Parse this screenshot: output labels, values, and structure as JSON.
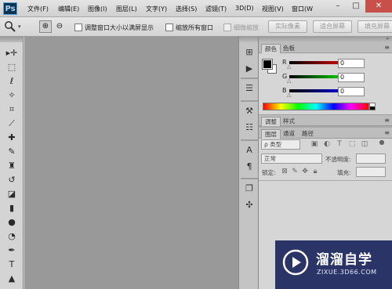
{
  "app": {
    "logo": "Ps"
  },
  "menubar": {
    "items": [
      "文件(F)",
      "编辑(E)",
      "图像(I)",
      "图层(L)",
      "文字(Y)",
      "选择(S)",
      "滤镜(T)",
      "3D(D)",
      "视图(V)",
      "窗口(W"
    ],
    "window_controls": {
      "minimize": "–",
      "maximize": "□",
      "close": "✕"
    }
  },
  "options": {
    "tool_icon": "zoom-icon",
    "zoom_in": "⊕",
    "zoom_out": "⊖",
    "resize_windows_label": "调整窗口大小以满屏显示",
    "zoom_all_windows_label": "缩放所有窗口",
    "scrubby_zoom_label": "细微缩放",
    "actual_pixels_button": "实际像素",
    "fit_screen_button": "适合屏幕",
    "fill_screen_button": "填充屏幕"
  },
  "tools": [
    {
      "name": "move-tool",
      "glyph": "▸✛"
    },
    {
      "name": "marquee-tool",
      "glyph": "⬚"
    },
    {
      "name": "lasso-tool",
      "glyph": "ℓ"
    },
    {
      "name": "quick-select-tool",
      "glyph": "✧"
    },
    {
      "name": "crop-tool",
      "glyph": "⌗"
    },
    {
      "name": "eyedropper-tool",
      "glyph": "⟋"
    },
    {
      "name": "healing-brush-tool",
      "glyph": "✚"
    },
    {
      "name": "brush-tool",
      "glyph": "✎"
    },
    {
      "name": "clone-stamp-tool",
      "glyph": "♜"
    },
    {
      "name": "history-brush-tool",
      "glyph": "↺"
    },
    {
      "name": "eraser-tool",
      "glyph": "◪"
    },
    {
      "name": "gradient-tool",
      "glyph": "▮"
    },
    {
      "name": "blur-tool",
      "glyph": "●"
    },
    {
      "name": "dodge-tool",
      "glyph": "◔"
    },
    {
      "name": "pen-tool",
      "glyph": "✒"
    },
    {
      "name": "type-tool",
      "glyph": "T"
    },
    {
      "name": "path-select-tool",
      "glyph": "▲"
    }
  ],
  "dock": {
    "icons": [
      {
        "name": "history-panel-icon",
        "glyph": "⊞"
      },
      {
        "name": "actions-play-icon",
        "glyph": "▶"
      },
      {
        "name": "properties-panel-icon",
        "glyph": "☰"
      },
      {
        "name": "tool-presets-icon",
        "glyph": "⚒"
      },
      {
        "name": "adjustments-panel-icon",
        "glyph": "☷"
      },
      {
        "name": "character-panel-icon",
        "glyph": "A"
      },
      {
        "name": "paragraph-panel-icon",
        "glyph": "¶"
      },
      {
        "name": "clone-source-icon",
        "glyph": "❐"
      },
      {
        "name": "brush-presets-icon",
        "glyph": "✣"
      }
    ]
  },
  "color_panel": {
    "tabs": [
      "颜色",
      "色板"
    ],
    "channels": [
      {
        "label": "R",
        "value": "0",
        "color_start": "#000000",
        "color_end": "#ff0000"
      },
      {
        "label": "G",
        "value": "0",
        "color_start": "#000000",
        "color_end": "#00ff00"
      },
      {
        "label": "B",
        "value": "0",
        "color_start": "#000000",
        "color_end": "#0000ff"
      }
    ],
    "foreground": "#000000",
    "background": "#ffffff"
  },
  "adjust_panel": {
    "tabs": [
      "调整",
      "样式"
    ]
  },
  "layers_panel": {
    "tabs": [
      "图层",
      "通道",
      "路径"
    ],
    "filter_kind": "ρ 类型",
    "blend_mode": "正常",
    "opacity_label": "不透明度:",
    "lock_label": "锁定:",
    "fill_label": "填充:"
  },
  "watermark": {
    "title": "溜溜自学",
    "url": "ZIXUE.3D66.COM"
  }
}
